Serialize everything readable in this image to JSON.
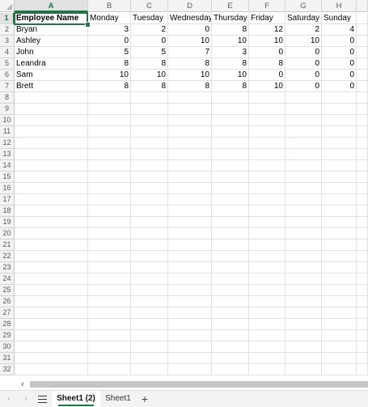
{
  "columns": [
    "A",
    "B",
    "C",
    "D",
    "E",
    "F",
    "G",
    "H"
  ],
  "row_numbers": [
    "1",
    "2",
    "3",
    "4",
    "5",
    "6",
    "7",
    "8",
    "9",
    "10",
    "11",
    "12",
    "13",
    "14",
    "15",
    "16",
    "17",
    "18",
    "19",
    "20",
    "21",
    "22",
    "23",
    "24",
    "25",
    "26",
    "27",
    "28",
    "29",
    "30",
    "31",
    "32"
  ],
  "selected_column": "A",
  "selected_row": "1",
  "header_row": [
    "Employee Name",
    "Monday",
    "Tuesday",
    "Wednesday",
    "Thursday",
    "Friday",
    "Saturday",
    "Sunday"
  ],
  "data_rows": [
    [
      "Bryan",
      "3",
      "2",
      "0",
      "8",
      "12",
      "2",
      "4"
    ],
    [
      "Ashley",
      "0",
      "0",
      "10",
      "10",
      "10",
      "10",
      "0"
    ],
    [
      "John",
      "5",
      "5",
      "7",
      "3",
      "0",
      "0",
      "0"
    ],
    [
      "Leandra",
      "8",
      "8",
      "8",
      "8",
      "8",
      "0",
      "0"
    ],
    [
      "Sam",
      "10",
      "10",
      "10",
      "10",
      "0",
      "0",
      "0"
    ],
    [
      "Brett",
      "8",
      "8",
      "8",
      "8",
      "10",
      "0",
      "0"
    ]
  ],
  "scroll_left_icon": "chevron-left-icon",
  "nav_prev_icon": "chevron-left-icon",
  "nav_next_icon": "chevron-right-icon",
  "menu_icon": "hamburger-menu-icon",
  "sheet_tabs": [
    {
      "label": "Sheet1 (2)",
      "active": true
    },
    {
      "label": "Sheet1",
      "active": false
    }
  ],
  "add_sheet_label": "+",
  "colors": {
    "accent": "#217346",
    "gridline": "#e1e1e1",
    "header_bg": "#f3f3f3",
    "header_selected_bg": "#e1e1e1"
  }
}
